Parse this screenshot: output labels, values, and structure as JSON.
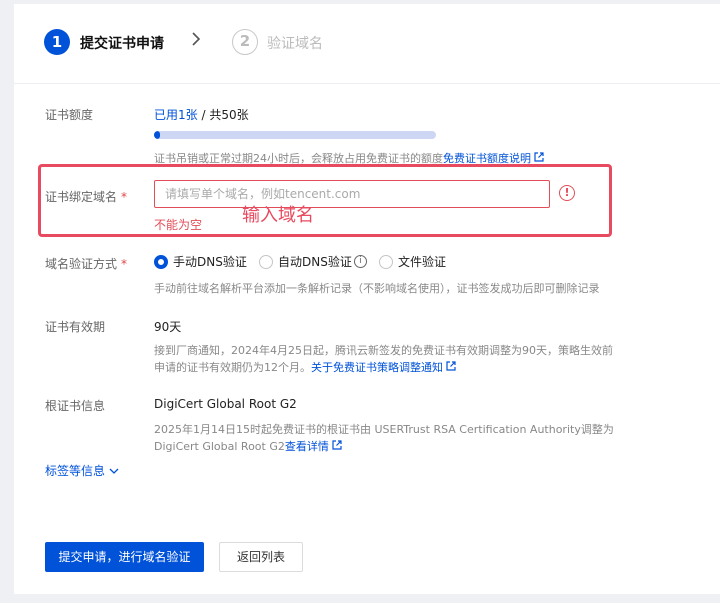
{
  "steps": [
    {
      "number": "1",
      "label": "提交证书申请"
    },
    {
      "number": "2",
      "label": "验证域名"
    }
  ],
  "quota": {
    "label": "证书额度",
    "used": "已用1张",
    "total": " / 共50张",
    "progress_fraction": 0.02,
    "note": "证书吊销或正常过期24小时后，会释放占用免费证书的额度",
    "note_link": "免费证书额度说明"
  },
  "domain": {
    "label": "证书绑定域名",
    "required_mark": "*",
    "placeholder": "请填写单个域名，例如tencent.com",
    "value": "",
    "error_icon": "!",
    "error": "不能为空",
    "annotation": "输入域名"
  },
  "verify": {
    "label": "域名验证方式",
    "required_mark": "*",
    "options": [
      {
        "label": "手动DNS验证",
        "checked": true
      },
      {
        "label": "自动DNS验证",
        "checked": false,
        "info": "i"
      },
      {
        "label": "文件验证",
        "checked": false
      }
    ],
    "hint": "手动前往域名解析平台添加一条解析记录（不影响域名使用），证书签发成功后即可删除记录"
  },
  "validity": {
    "label": "证书有效期",
    "value": "90天",
    "notice_line1": "接到厂商通知，2024年4月25日起，腾讯云新签发的免费证书有效期调整为90天，策略生效前",
    "notice_line2": "申请的证书有效期仍为12个月。",
    "notice_link": "关于免费证书策略调整通知"
  },
  "root_cert": {
    "label": "根证书信息",
    "value": "DigiCert Global Root G2",
    "notice_line1": "2025年1月14日15时起免费证书的根证书由 USERTrust RSA Certification Authority调整为",
    "notice_line2": "DigiCert Global Root G2",
    "notice_link": "查看详情"
  },
  "more": {
    "label": "标签等信息"
  },
  "buttons": {
    "submit": "提交申请，进行域名验证",
    "back": "返回列表"
  },
  "colors": {
    "primary": "#0052d9",
    "error": "#e34d59",
    "annotation": "#e84a5f"
  },
  "icons": {
    "step_chevron": "chevron-right-icon",
    "external_link": "external-link-icon",
    "expand": "chevron-down-icon"
  }
}
